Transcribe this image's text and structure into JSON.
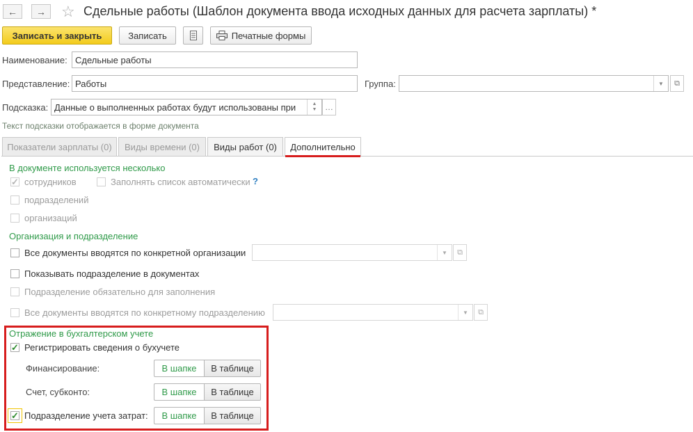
{
  "window": {
    "title": "Сдельные работы (Шаблон документа ввода исходных данных для расчета зарплаты) *",
    "back_icon": "arrow-left-icon",
    "forward_icon": "arrow-right-icon",
    "favorite_icon": "star-icon"
  },
  "toolbar": {
    "save_close": "Записать и закрыть",
    "save": "Записать",
    "print_forms": "Печатные формы"
  },
  "form": {
    "name_label": "Наименование:",
    "name_value": "Сдельные работы",
    "repr_label": "Представление:",
    "repr_value": "Работы",
    "group_label": "Группа:",
    "group_value": "",
    "hint_label": "Подсказка:",
    "hint_value": "Данные о выполненных работах будут использованы при",
    "hint_note": "Текст подсказки отображается в форме документа"
  },
  "tabs": [
    {
      "label": "Показатели зарплаты (0)"
    },
    {
      "label": "Виды времени (0)"
    },
    {
      "label": "Виды работ (0)"
    },
    {
      "label": "Дополнительно"
    }
  ],
  "sections": {
    "used_title": "В документе используется несколько",
    "employees": "сотрудников",
    "fill_auto": "Заполнять список автоматически",
    "help_mark": "?",
    "departments": "подразделений",
    "organizations": "организаций",
    "org_title": "Организация и подразделение",
    "all_docs_org": "Все документы вводятся по конкретной организации",
    "show_dept": "Показывать подразделение в документах",
    "dept_required": "Подразделение обязательно для заполнения",
    "all_docs_dept": "Все документы вводятся по конкретному подразделению",
    "acc_title": "Отражение в бухгалтерском учете",
    "register_acc": "Регистрировать сведения о бухучете",
    "financing": "Финансирование:",
    "account": "Счет, субконто:",
    "cost_dept": "Подразделение учета затрат:",
    "in_header": "В шапке",
    "in_table": "В таблице"
  },
  "colors": {
    "accent_green": "#2f9a49",
    "primary_yellow": "#f3cc1c",
    "highlight_red": "#d71d1d"
  }
}
